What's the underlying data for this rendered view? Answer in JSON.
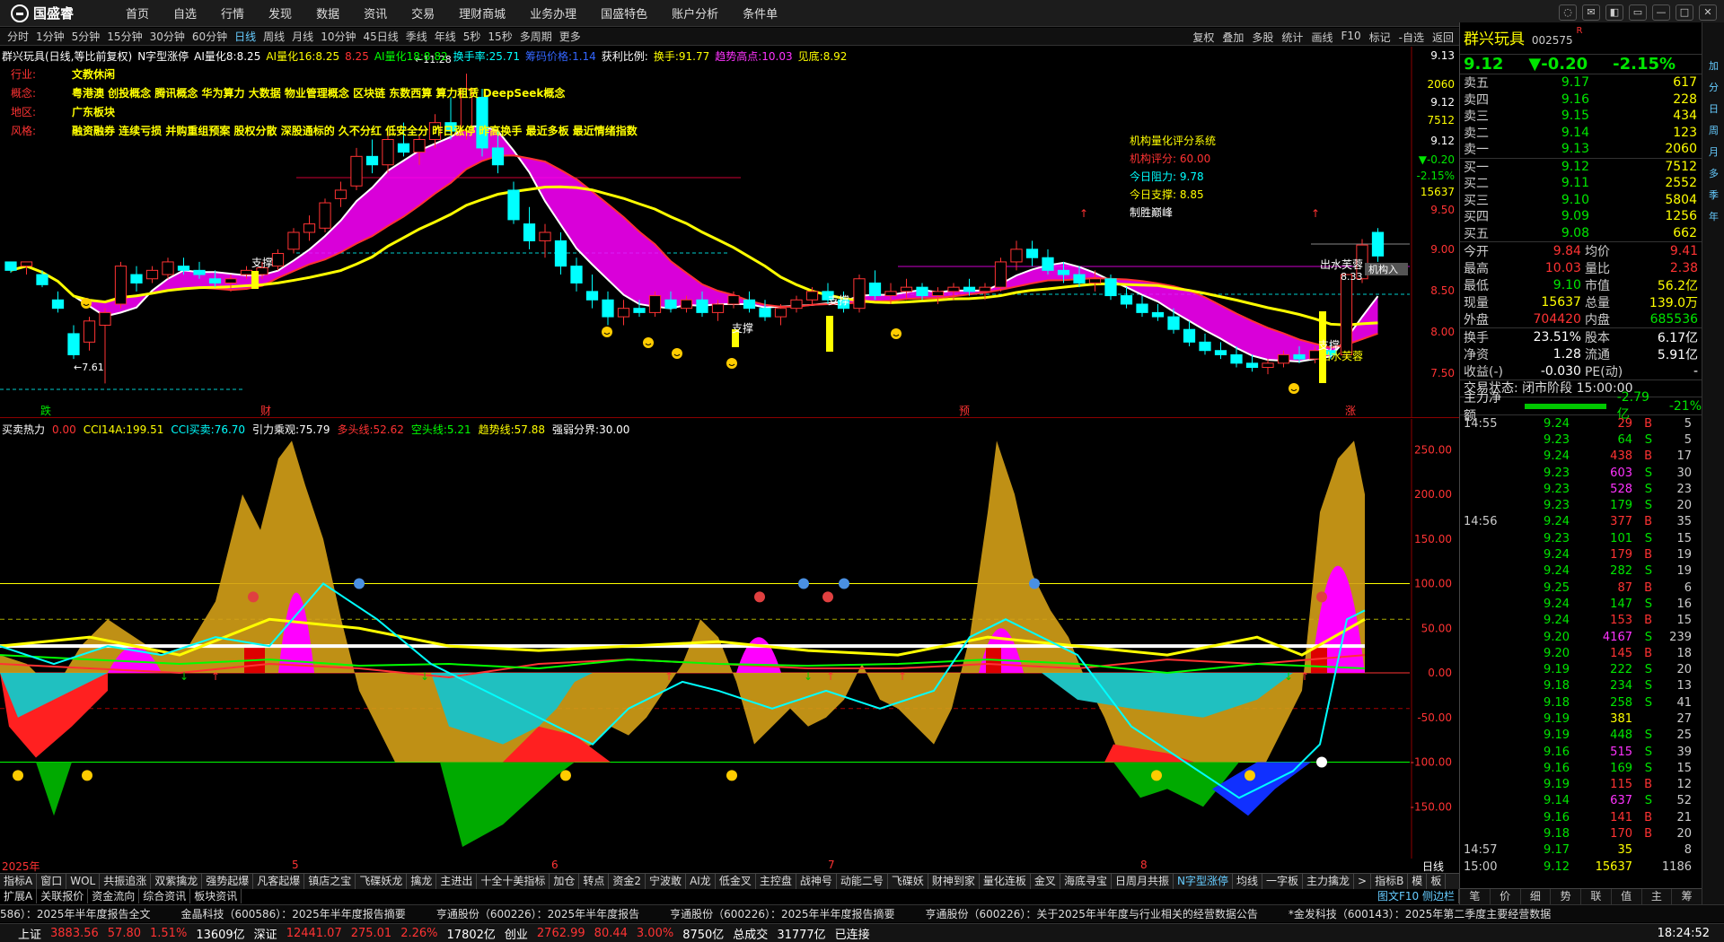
{
  "app": {
    "logo_text": "国盛睿"
  },
  "menu": [
    "首页",
    "自选",
    "行情",
    "发现",
    "数据",
    "资讯",
    "交易",
    "理财商城",
    "业务办理",
    "国盛特色",
    "账户分析",
    "条件单"
  ],
  "window_controls": [
    "chat-icon",
    "mail-icon",
    "skin-icon",
    "layout-icon",
    "minimize-icon",
    "maximize-icon",
    "close-icon"
  ],
  "periods": [
    "分时",
    "1分钟",
    "5分钟",
    "15分钟",
    "30分钟",
    "60分钟",
    "日线",
    "周线",
    "月线",
    "10分钟",
    "45日线",
    "季线",
    "年线",
    "5秒",
    "15秒",
    "多周期",
    "更多"
  ],
  "period_active": "日线",
  "period_right": [
    "复权",
    "叠加",
    "多股",
    "统计",
    "画线",
    "F10",
    "标记",
    "-自选",
    "返回"
  ],
  "main_title": {
    "name": "群兴玩具(日线,等比前复权)",
    "ind_name": "N字型涨停",
    "items": [
      {
        "label": "AI量化8:",
        "value": "8.25",
        "color": "#ffffff"
      },
      {
        "label": "AI量化16:",
        "value": "8.25",
        "color": "#ffff00"
      },
      {
        "label": "",
        "value": "8.25",
        "color": "#ff3333"
      },
      {
        "label": "AI量化18:",
        "value": "8.82",
        "color": "#00ff00"
      },
      {
        "label": "换手率:",
        "value": "25.71",
        "color": "#00ffff"
      },
      {
        "label": "筹码价格:",
        "value": "1.14",
        "color": "#3366ff"
      },
      {
        "label": "获利比例:",
        "value": "",
        "color": "#ffffff"
      },
      {
        "label": "换手:",
        "value": "91.77",
        "color": "#ffff00"
      },
      {
        "label": "趋势高点:",
        "value": "10.03",
        "color": "#ff33ff"
      },
      {
        "label": "见底:",
        "value": "8.92",
        "color": "#ffff00"
      }
    ]
  },
  "profile": [
    {
      "key": "行业:",
      "value": "文教休闲"
    },
    {
      "key": "概念:",
      "value": "粤港澳 创投概念 腾讯概念 华为算力 大数据 物业管理概念 区块链 东数西算 算力租赁 DeepSeek概念"
    },
    {
      "key": "地区:",
      "value": "广东板块"
    },
    {
      "key": "风格:",
      "value": "融资融券 连续亏损 并购重组预案 股权分散 深股通标的 久不分红 低安全分 昨日涨停 昨高换手 最近多板 最近情绪指数"
    }
  ],
  "jg_system": {
    "title": "机构量化评分系统",
    "score_label": "机构评分:",
    "score": "60.00",
    "resist_label": "今日阻力:",
    "resist": "9.78",
    "support_label": "今日支撑:",
    "support": "8.85",
    "note": "制胜巅峰"
  },
  "chart_labels": {
    "high": "11.28",
    "low": "7.61",
    "support": "支撑",
    "out": "出水芙蓉",
    "jg_tag": "机构入",
    "price_tag": "8.33"
  },
  "chart_data": {
    "type": "candlestick",
    "y_ticks_main": [
      "9.13",
      "2060",
      "9.12",
      "7512",
      "9.12",
      "▼-0.20",
      "-2.15%",
      "15637",
      "9.50",
      "9.00",
      "8.50",
      "8.00",
      "7.50"
    ],
    "ylim_main": [
      7.2,
      11.6
    ],
    "x_labels": [
      "2025年",
      "5",
      "6",
      "7",
      "8"
    ],
    "ohlc": [
      [
        9.05,
        9.05,
        8.92,
        8.95
      ],
      [
        9.0,
        9.05,
        8.9,
        9.05
      ],
      [
        8.9,
        8.95,
        8.75,
        8.78
      ],
      [
        8.6,
        8.7,
        8.45,
        8.5
      ],
      [
        8.2,
        8.3,
        7.9,
        7.95
      ],
      [
        8.1,
        8.4,
        8.0,
        8.35
      ],
      [
        8.3,
        8.5,
        7.61,
        8.45
      ],
      [
        8.55,
        9.05,
        8.5,
        9.0
      ],
      [
        8.9,
        9.0,
        8.7,
        8.8
      ],
      [
        8.85,
        9.0,
        8.8,
        8.95
      ],
      [
        8.9,
        9.1,
        8.85,
        9.05
      ],
      [
        9.0,
        9.1,
        8.9,
        8.95
      ],
      [
        8.95,
        9.05,
        8.85,
        8.9
      ],
      [
        8.85,
        8.95,
        8.75,
        8.8
      ],
      [
        8.8,
        8.9,
        8.7,
        8.85
      ],
      [
        8.9,
        9.0,
        8.85,
        8.95
      ],
      [
        8.9,
        9.05,
        8.85,
        8.98
      ],
      [
        9.0,
        9.2,
        8.95,
        9.15
      ],
      [
        9.2,
        9.45,
        9.15,
        9.4
      ],
      [
        9.4,
        9.6,
        9.3,
        9.5
      ],
      [
        9.45,
        9.8,
        9.4,
        9.75
      ],
      [
        9.8,
        10.0,
        9.7,
        9.9
      ],
      [
        9.95,
        10.4,
        9.9,
        10.3
      ],
      [
        10.3,
        10.5,
        10.1,
        10.2
      ],
      [
        10.2,
        10.6,
        10.1,
        10.5
      ],
      [
        10.45,
        10.7,
        10.3,
        10.35
      ],
      [
        10.35,
        10.55,
        10.2,
        10.5
      ],
      [
        10.5,
        10.8,
        10.4,
        10.7
      ],
      [
        10.7,
        11.0,
        10.5,
        10.6
      ],
      [
        10.6,
        11.28,
        10.5,
        11.1
      ],
      [
        11.0,
        11.1,
        10.3,
        10.4
      ],
      [
        10.4,
        10.6,
        10.1,
        10.2
      ],
      [
        9.9,
        10.0,
        9.5,
        9.55
      ],
      [
        9.5,
        9.7,
        9.2,
        9.3
      ],
      [
        9.3,
        9.5,
        9.1,
        9.4
      ],
      [
        9.3,
        9.4,
        8.9,
        9.0
      ],
      [
        9.0,
        9.1,
        8.7,
        8.8
      ],
      [
        8.7,
        8.9,
        8.5,
        8.6
      ],
      [
        8.6,
        8.7,
        8.3,
        8.4
      ],
      [
        8.4,
        8.6,
        8.3,
        8.5
      ],
      [
        8.5,
        8.6,
        8.4,
        8.45
      ],
      [
        8.45,
        8.7,
        8.4,
        8.65
      ],
      [
        8.6,
        8.7,
        8.45,
        8.5
      ],
      [
        8.5,
        8.65,
        8.45,
        8.6
      ],
      [
        8.6,
        8.7,
        8.4,
        8.45
      ],
      [
        8.45,
        8.6,
        8.35,
        8.55
      ],
      [
        8.55,
        8.7,
        8.5,
        8.65
      ],
      [
        8.6,
        8.7,
        8.45,
        8.5
      ],
      [
        8.5,
        8.6,
        8.35,
        8.4
      ],
      [
        8.4,
        8.55,
        8.3,
        8.5
      ],
      [
        8.5,
        8.65,
        8.45,
        8.6
      ],
      [
        8.6,
        8.75,
        8.55,
        8.7
      ],
      [
        8.7,
        8.8,
        8.55,
        8.6
      ],
      [
        8.6,
        8.7,
        8.45,
        8.5
      ],
      [
        8.5,
        8.9,
        8.45,
        8.85
      ],
      [
        8.8,
        8.95,
        8.6,
        8.65
      ],
      [
        8.65,
        8.8,
        8.55,
        8.7
      ],
      [
        8.7,
        8.85,
        8.6,
        8.75
      ],
      [
        8.75,
        8.8,
        8.6,
        8.65
      ],
      [
        8.65,
        8.75,
        8.55,
        8.7
      ],
      [
        8.7,
        8.8,
        8.6,
        8.75
      ],
      [
        8.75,
        8.85,
        8.65,
        8.7
      ],
      [
        8.7,
        8.8,
        8.6,
        8.75
      ],
      [
        8.75,
        9.1,
        8.7,
        9.05
      ],
      [
        9.05,
        9.3,
        8.95,
        9.2
      ],
      [
        9.2,
        9.3,
        9.0,
        9.1
      ],
      [
        9.1,
        9.2,
        8.9,
        8.95
      ],
      [
        8.95,
        9.05,
        8.8,
        8.9
      ],
      [
        8.9,
        9.0,
        8.75,
        8.8
      ],
      [
        8.8,
        8.95,
        8.7,
        8.85
      ],
      [
        8.85,
        8.9,
        8.6,
        8.65
      ],
      [
        8.65,
        8.75,
        8.5,
        8.55
      ],
      [
        8.55,
        8.65,
        8.4,
        8.45
      ],
      [
        8.45,
        8.55,
        8.35,
        8.4
      ],
      [
        8.4,
        8.5,
        8.2,
        8.25
      ],
      [
        8.25,
        8.35,
        8.05,
        8.1
      ],
      [
        8.1,
        8.2,
        7.95,
        8.0
      ],
      [
        8.0,
        8.1,
        7.9,
        7.95
      ],
      [
        7.95,
        8.05,
        7.8,
        7.85
      ],
      [
        7.85,
        7.95,
        7.75,
        7.8
      ],
      [
        7.8,
        7.9,
        7.72,
        7.85
      ],
      [
        7.85,
        8.0,
        7.8,
        7.95
      ],
      [
        7.95,
        8.05,
        7.85,
        7.9
      ],
      [
        7.9,
        8.05,
        7.85,
        8.0
      ],
      [
        8.0,
        8.1,
        7.9,
        7.95
      ],
      [
        7.95,
        8.9,
        7.9,
        8.9
      ],
      [
        8.85,
        9.32,
        8.8,
        9.25
      ],
      [
        9.4,
        9.45,
        9.05,
        9.12
      ]
    ],
    "ma_lines": [
      "AI量化8",
      "AI量化16",
      "AI量化18"
    ]
  },
  "ind_title": {
    "name": "买卖热力",
    "items": [
      {
        "label": "",
        "value": "0.00",
        "color": "#ff3333"
      },
      {
        "label": "CCI14A:",
        "value": "199.51",
        "color": "#ffff00"
      },
      {
        "label": "CCI买卖:",
        "value": "76.70",
        "color": "#00ffff"
      },
      {
        "label": "引力乘观:",
        "value": "75.79",
        "color": "#ffffff"
      },
      {
        "label": "多头线:",
        "value": "52.62",
        "color": "#ff3333"
      },
      {
        "label": "空头线:",
        "value": "5.21",
        "color": "#00ff00"
      },
      {
        "label": "趋势线:",
        "value": "57.88",
        "color": "#ffff00"
      },
      {
        "label": "强弱分界:",
        "value": "30.00",
        "color": "#ffffff"
      }
    ]
  },
  "ind_axis": [
    "250.00",
    "200.00",
    "150.00",
    "100.00",
    "50.00",
    "0.00",
    "-50.00",
    "-100.00",
    "-150.00"
  ],
  "date_labels": [
    "2025年",
    "5",
    "6",
    "7",
    "8"
  ],
  "date_right": "日线",
  "event_labels": [
    "跌",
    "财",
    "预",
    "涨"
  ],
  "tabs1": [
    "指标A",
    "窗口",
    "WOL",
    "共振追涨",
    "双紫擒龙",
    "强势起爆",
    "凡客起爆",
    "镇店之宝",
    "飞碟妖龙",
    "擒龙",
    "主进出",
    "十全十美指标",
    "加仓",
    "转点",
    "资金2",
    "宁波敢",
    "AI龙",
    "低金叉",
    "主控盘",
    "战神号",
    "动能二号",
    "飞碟妖",
    "财神到家",
    "量化连板",
    "金叉",
    "海底寻宝",
    "日周月共振",
    "N字型涨停",
    "均线",
    "一字板",
    "主力擒龙",
    ">",
    "指标B",
    "模",
    "板"
  ],
  "tabs2": [
    "扩展A",
    "关联报价",
    "资金流向",
    "综合资讯",
    "板块资讯"
  ],
  "tabs2_right": "图文F10 侧边栏",
  "news": [
    "586）：2025年半年度报告全文",
    "金晶科技（600586）：2025年半年度报告摘要",
    "亨通股份（600226）：2025年半年度报告",
    "亨通股份（600226）：2025年半年度报告摘要",
    "亨通股份（600226）：关于2025年半年度与行业相关的经营数据公告",
    "*金发科技（600143）：2025年第二季度主要经营数据"
  ],
  "status": {
    "sh_label": "上证",
    "sh": "3883.56",
    "sh_chg": "57.80",
    "sh_pct": "1.51%",
    "sh_vol": "13609亿",
    "sz_label": "深证",
    "sz": "12441.07",
    "sz_chg": "275.01",
    "sz_pct": "2.26%",
    "sz_vol": "17802亿",
    "cy_label": "创业",
    "cy": "2762.99",
    "cy_chg": "80.44",
    "cy_pct": "3.00%",
    "cy_vol": "8750亿",
    "total_label": "总成交",
    "total": "31777亿",
    "conn": "已连接",
    "time": "18:24:52"
  },
  "rpanel": {
    "name": "群兴玩具",
    "code": "002575",
    "flag": "R",
    "price": "9.12",
    "chg": "▼-0.20",
    "pct": "-2.15%",
    "asks": [
      [
        "卖五",
        "9.17",
        "617"
      ],
      [
        "卖四",
        "9.16",
        "228"
      ],
      [
        "卖三",
        "9.15",
        "434"
      ],
      [
        "卖二",
        "9.14",
        "123"
      ],
      [
        "卖一",
        "9.13",
        "2060"
      ]
    ],
    "bids": [
      [
        "买一",
        "9.12",
        "7512"
      ],
      [
        "买二",
        "9.11",
        "2552"
      ],
      [
        "买三",
        "9.10",
        "5804"
      ],
      [
        "买四",
        "9.09",
        "1256"
      ],
      [
        "买五",
        "9.08",
        "662"
      ]
    ],
    "stats1": [
      [
        "今开",
        "9.84",
        "均价",
        "9.41"
      ],
      [
        "最高",
        "10.03",
        "量比",
        "2.38"
      ],
      [
        "最低",
        "9.10",
        "市值",
        "56.2亿"
      ],
      [
        "现量",
        "15637",
        "总量",
        "139.0万"
      ],
      [
        "外盘",
        "704420",
        "内盘",
        "685536"
      ]
    ],
    "stats2": [
      [
        "换手",
        "23.51%",
        "股本",
        "6.17亿"
      ],
      [
        "净资",
        "1.28",
        "流通",
        "5.91亿"
      ],
      [
        "收益(-)",
        "-0.030",
        "PE(动)",
        "-"
      ]
    ],
    "trade_state": "交易状态: 闭市阶段 15:00:00",
    "netflow_label": "主力净额",
    "netflow": "-2.79亿",
    "netflow_pct": "-21%",
    "ticks": [
      [
        "14:55",
        "9.24",
        "29",
        "B",
        "5"
      ],
      [
        "",
        "9.23",
        "64",
        "S",
        "5"
      ],
      [
        "",
        "9.24",
        "438",
        "B",
        "17"
      ],
      [
        "",
        "9.23",
        "603",
        "S",
        "30"
      ],
      [
        "",
        "9.23",
        "528",
        "S",
        "23"
      ],
      [
        "",
        "9.23",
        "179",
        "S",
        "20"
      ],
      [
        "14:56",
        "9.24",
        "377",
        "B",
        "35"
      ],
      [
        "",
        "9.23",
        "101",
        "S",
        "15"
      ],
      [
        "",
        "9.24",
        "179",
        "B",
        "19"
      ],
      [
        "",
        "9.24",
        "282",
        "S",
        "19"
      ],
      [
        "",
        "9.25",
        "87",
        "B",
        "6"
      ],
      [
        "",
        "9.24",
        "147",
        "S",
        "16"
      ],
      [
        "",
        "9.24",
        "153",
        "B",
        "15"
      ],
      [
        "",
        "9.20",
        "4167",
        "S",
        "239"
      ],
      [
        "",
        "9.20",
        "145",
        "B",
        "18"
      ],
      [
        "",
        "9.19",
        "222",
        "S",
        "20"
      ],
      [
        "",
        "9.18",
        "234",
        "S",
        "13"
      ],
      [
        "",
        "9.18",
        "258",
        "S",
        "41"
      ],
      [
        "",
        "9.19",
        "381",
        "",
        "27"
      ],
      [
        "",
        "9.19",
        "448",
        "S",
        "25"
      ],
      [
        "",
        "9.16",
        "515",
        "S",
        "39"
      ],
      [
        "",
        "9.16",
        "169",
        "S",
        "15"
      ],
      [
        "",
        "9.19",
        "115",
        "B",
        "12"
      ],
      [
        "",
        "9.14",
        "637",
        "S",
        "52"
      ],
      [
        "",
        "9.16",
        "141",
        "B",
        "21"
      ],
      [
        "",
        "9.18",
        "170",
        "B",
        "20"
      ],
      [
        "14:57",
        "9.17",
        "35",
        "",
        "8"
      ],
      [
        "15:00",
        "9.12",
        "15637",
        "",
        "1186"
      ]
    ],
    "tabs": [
      "笔",
      "价",
      "细",
      "势",
      "联",
      "值",
      "主",
      "筹"
    ]
  },
  "side_strip": [
    "加",
    "分",
    "日",
    "周",
    "月",
    "多",
    "季",
    "年"
  ]
}
